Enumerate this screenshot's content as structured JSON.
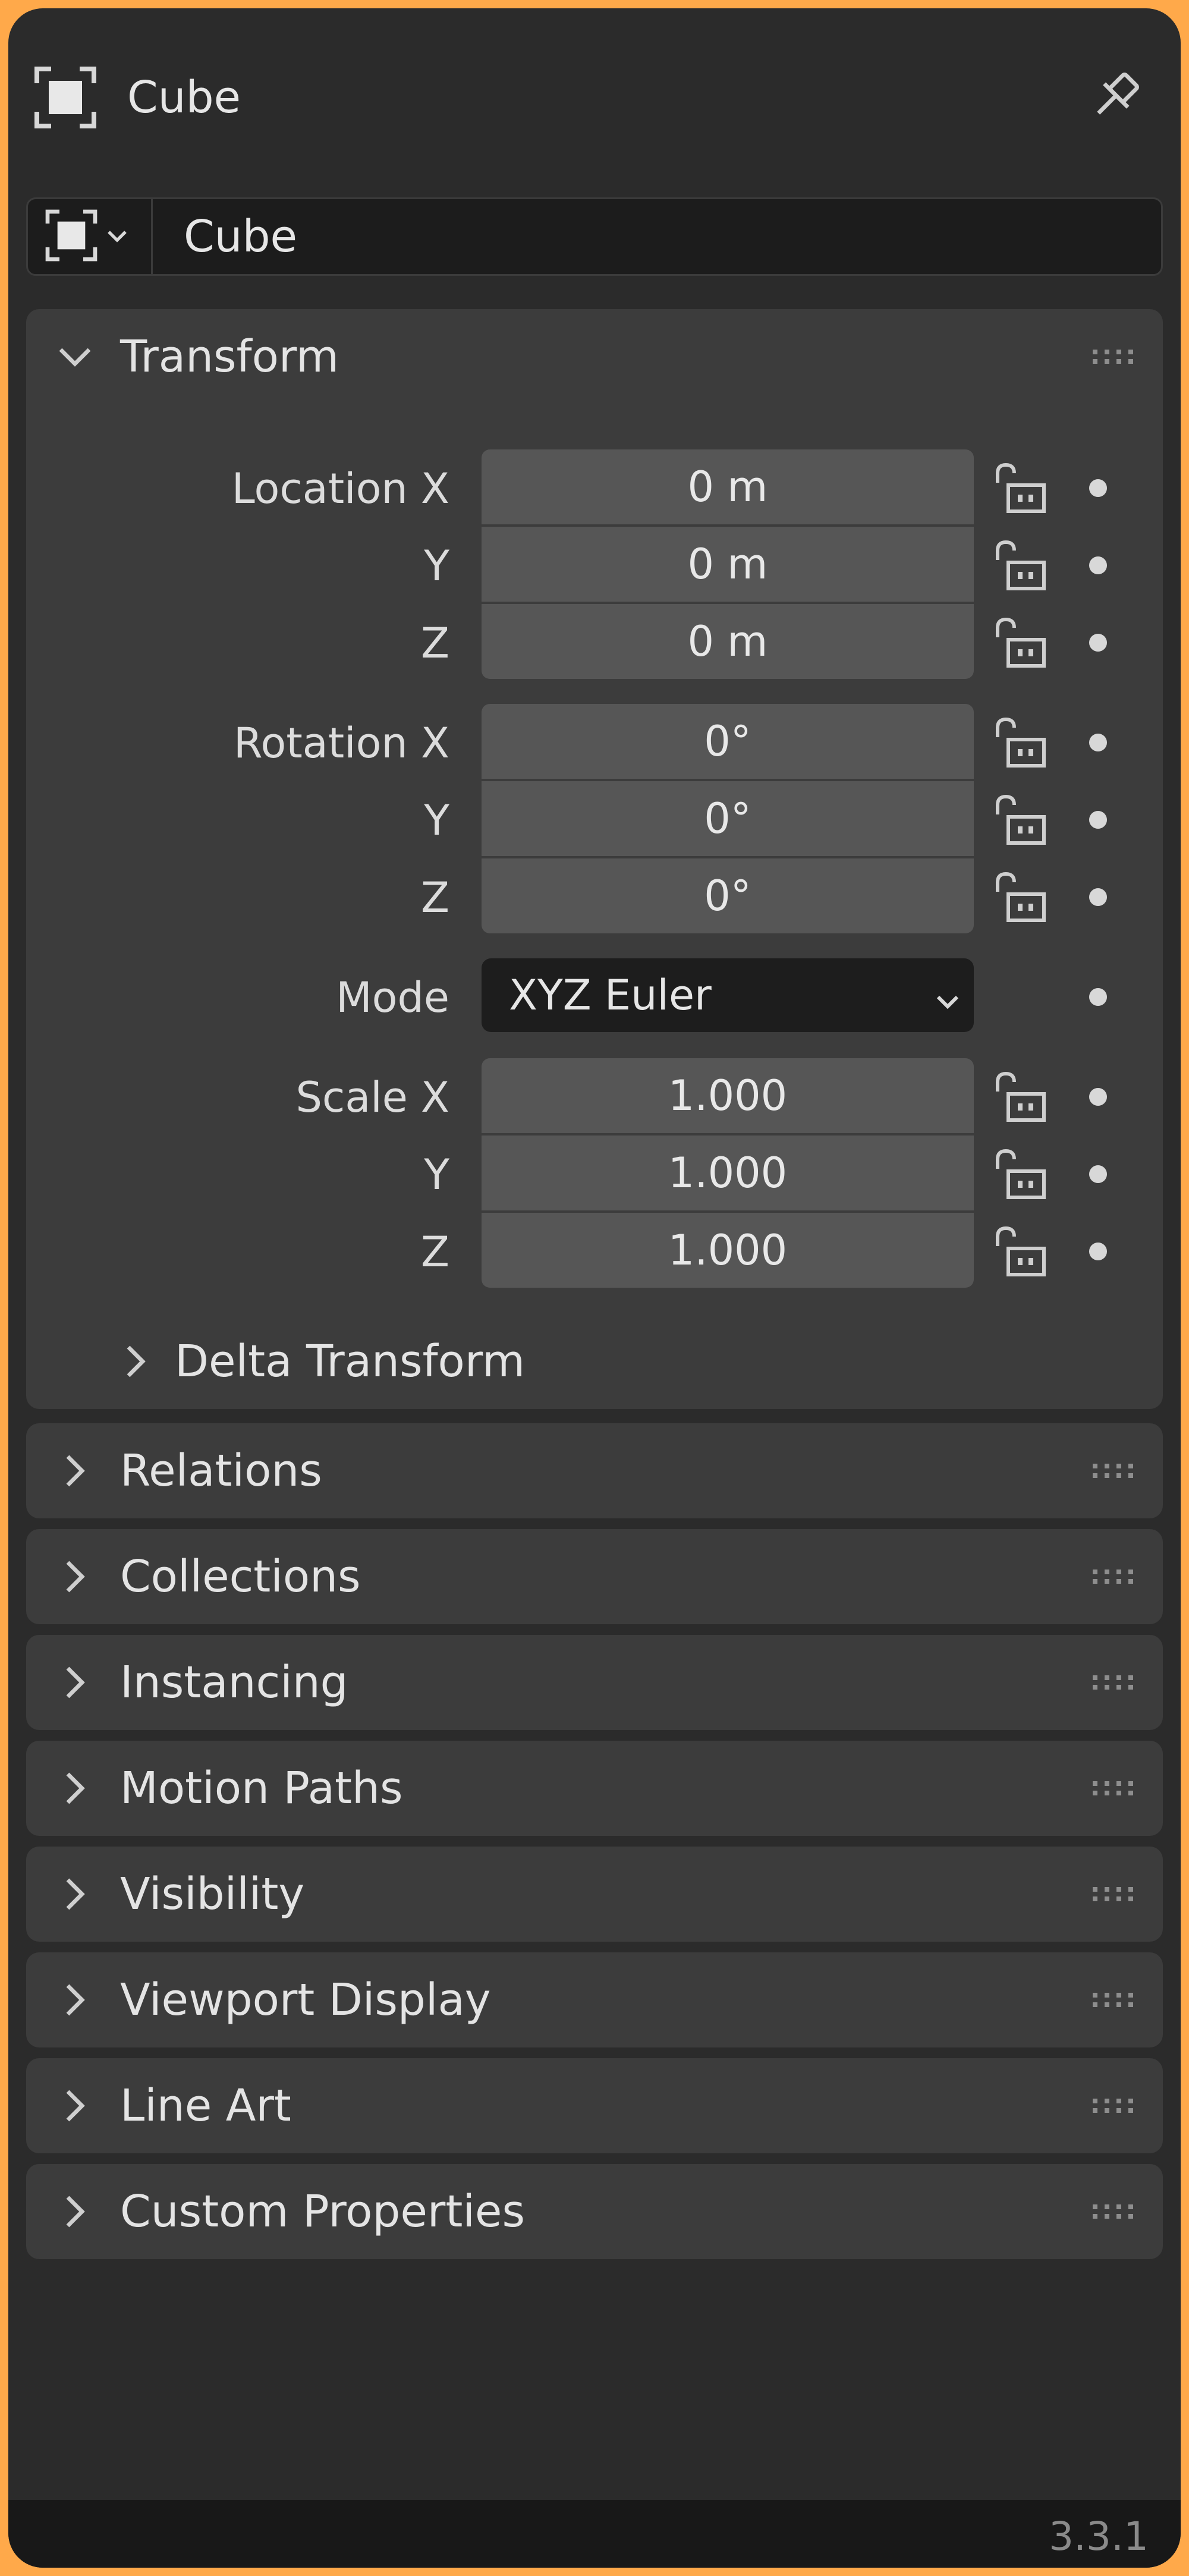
{
  "header": {
    "title": "Cube",
    "object_icon": "object-data-icon",
    "pin_icon": "pin-icon"
  },
  "name_row": {
    "type_icon": "object-data-icon",
    "value": "Cube"
  },
  "transform": {
    "title": "Transform",
    "location": {
      "label_x": "Location X",
      "label_y": "Y",
      "label_z": "Z",
      "x": "0 m",
      "y": "0 m",
      "z": "0 m"
    },
    "rotation": {
      "label_x": "Rotation X",
      "label_y": "Y",
      "label_z": "Z",
      "x": "0°",
      "y": "0°",
      "z": "0°"
    },
    "mode": {
      "label": "Mode",
      "value": "XYZ Euler"
    },
    "scale": {
      "label_x": "Scale X",
      "label_y": "Y",
      "label_z": "Z",
      "x": "1.000",
      "y": "1.000",
      "z": "1.000"
    },
    "delta": "Delta Transform"
  },
  "panels": [
    "Relations",
    "Collections",
    "Instancing",
    "Motion Paths",
    "Visibility",
    "Viewport Display",
    "Line Art",
    "Custom Properties"
  ],
  "footer": {
    "version": "3.3.1"
  },
  "colors": {
    "frame": "#ffa94a",
    "background": "#2b2b2b",
    "panel": "#3c3c3c",
    "field": "#565656",
    "dark_field": "#1c1c1c"
  }
}
